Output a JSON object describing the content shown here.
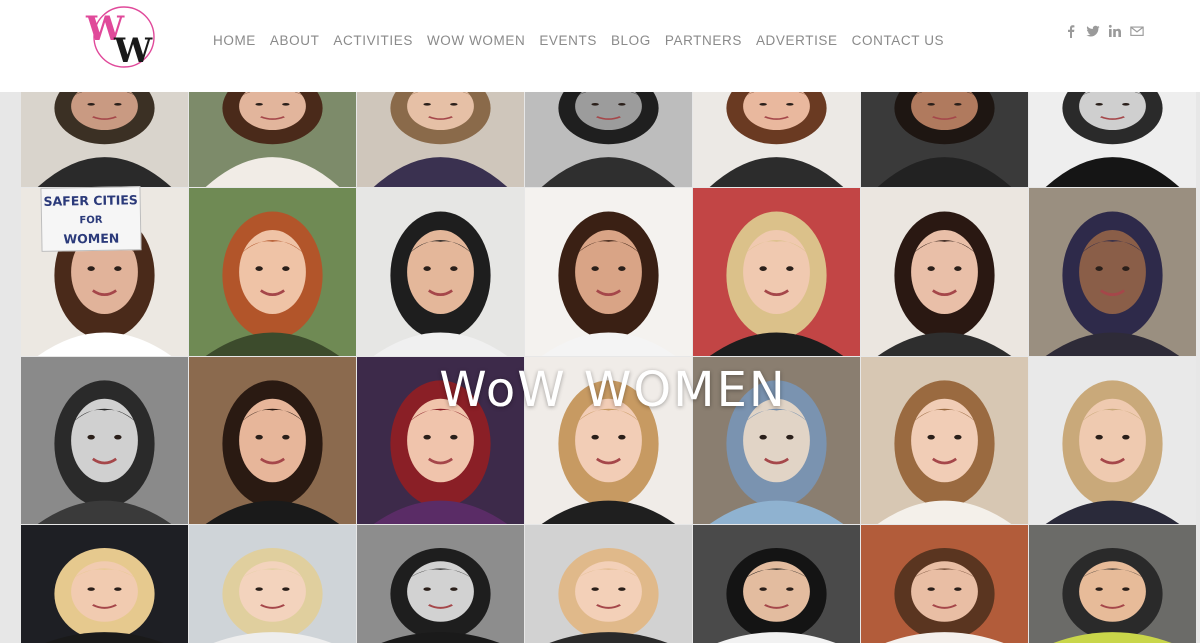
{
  "logo": {
    "alt_letters": "WW",
    "colors": {
      "pink": "#e0499a",
      "dark": "#1a1a1a"
    }
  },
  "nav": {
    "items": [
      {
        "label": "HOME"
      },
      {
        "label": "ABOUT"
      },
      {
        "label": "ACTIVITIES"
      },
      {
        "label": "WOW WOMEN"
      },
      {
        "label": "EVENTS"
      },
      {
        "label": "BLOG"
      },
      {
        "label": "PARTNERS"
      },
      {
        "label": "ADVERTISE"
      },
      {
        "label": "CONTACT US"
      }
    ]
  },
  "social": {
    "icons": [
      "facebook-icon",
      "twitter-icon",
      "linkedin-icon",
      "mail-icon"
    ],
    "color": "#9a9a9a"
  },
  "hero": {
    "title": "WoW WOMEN",
    "sign_text": "SAFER CITIES FOR WOMEN",
    "tile_count": 28
  }
}
